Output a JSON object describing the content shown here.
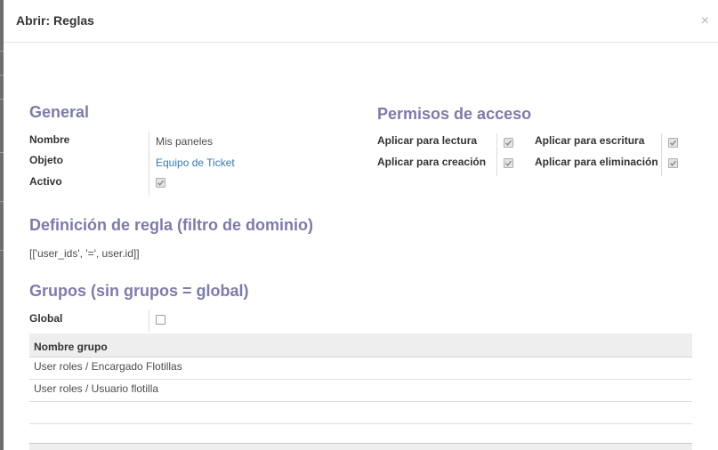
{
  "dialog": {
    "title": "Abrir: Reglas",
    "close_glyph": "×"
  },
  "general": {
    "title": "General",
    "name_label": "Nombre",
    "name_value": "Mis paneles",
    "object_label": "Objeto",
    "object_value": "Equipo de Ticket",
    "active_label": "Activo",
    "active_checked": true
  },
  "access": {
    "title": "Permisos de acceso",
    "read_label": "Aplicar para lectura",
    "write_label": "Aplicar para escritura",
    "create_label": "Aplicar para creación",
    "delete_label": "Aplicar para eliminación",
    "read_checked": true,
    "write_checked": true,
    "create_checked": true,
    "delete_checked": true
  },
  "rule": {
    "title": "Definición de regla (filtro de dominio)",
    "domain": "[['user_ids', '=', user.id]]"
  },
  "groups": {
    "title": "Grupos (sin grupos = global)",
    "global_label": "Global",
    "global_checked": false,
    "column_header": "Nombre grupo",
    "rows": [
      "User roles / Encargado Flotillas",
      "User roles / Usuario flotilla"
    ]
  },
  "colors": {
    "section_title": "#7c7bad",
    "link": "#337ab7"
  }
}
